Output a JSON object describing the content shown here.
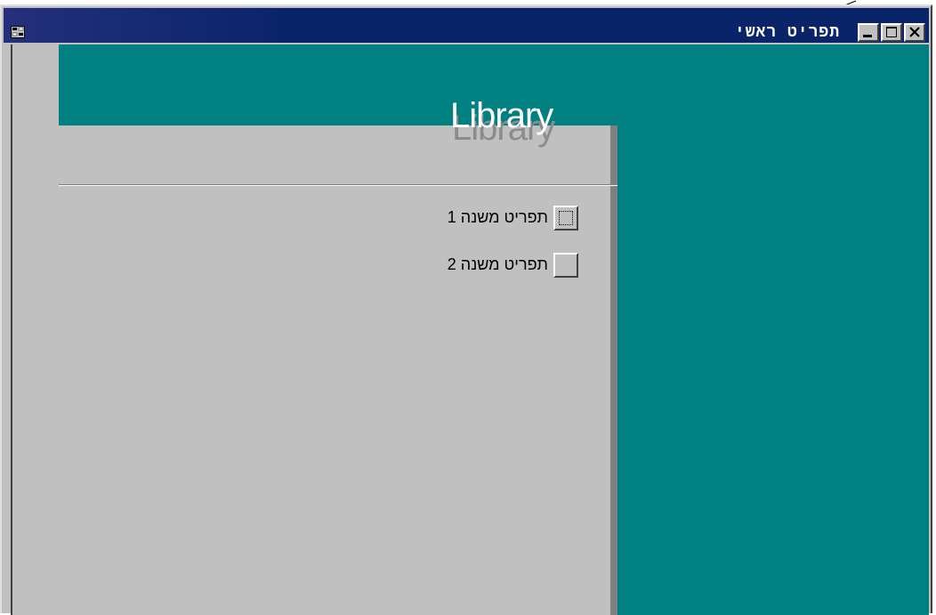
{
  "window": {
    "title": "תפריט ראשי",
    "controls": {
      "minimize": "minimize",
      "maximize": "maximize",
      "close": "close"
    }
  },
  "form": {
    "heading": "Library",
    "menu_items": [
      {
        "label": "תפריט משנה 1",
        "focused": true
      },
      {
        "label": "תפריט משנה 2",
        "focused": false
      }
    ]
  },
  "colors": {
    "titlebar": "#0a246a",
    "teal": "#008080",
    "face": "#c0c0c0"
  }
}
